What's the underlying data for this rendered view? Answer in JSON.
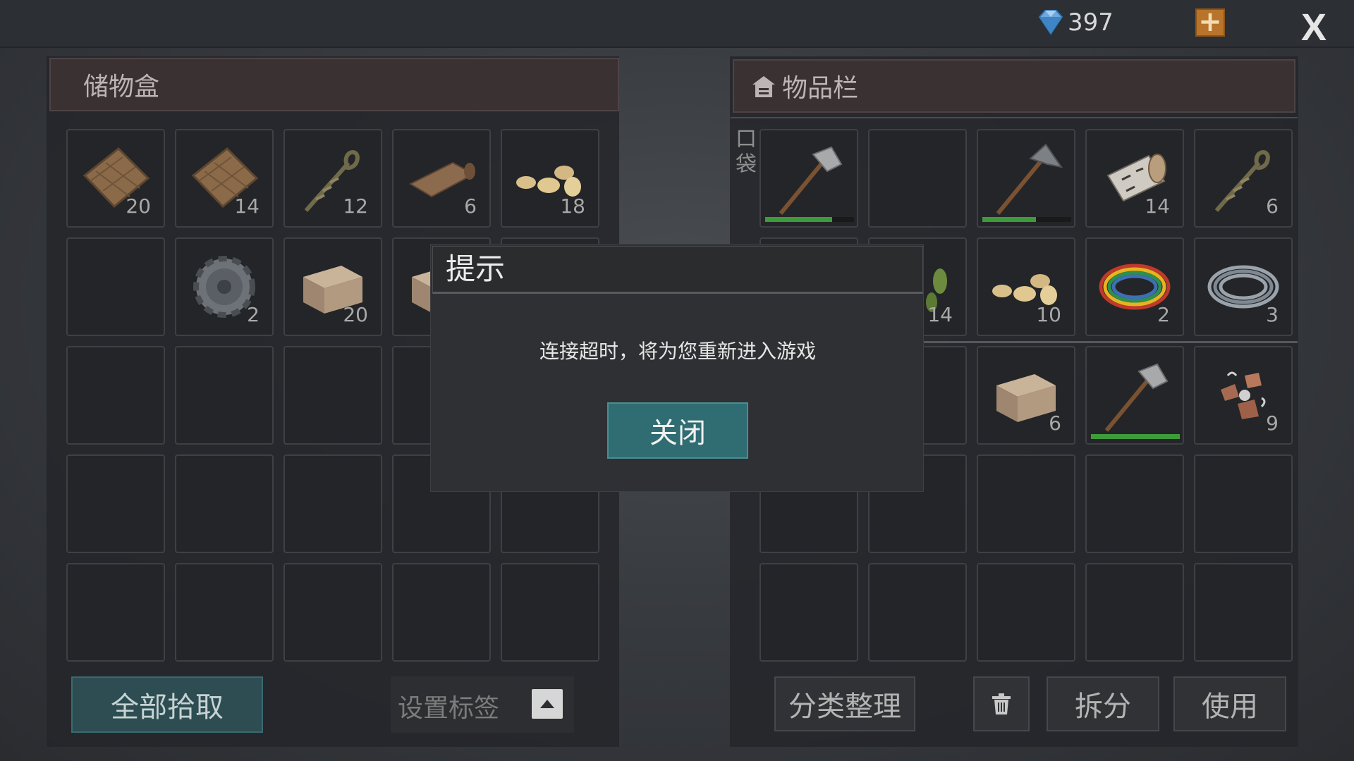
{
  "top": {
    "gem_icon": "diamond-icon",
    "gem_count": "397",
    "add_label": "+",
    "close_label": "X"
  },
  "storage": {
    "title": "储物盒",
    "slots": [
      {
        "item": "burlap-cloth",
        "count": "20"
      },
      {
        "item": "burlap-cloth",
        "count": "14"
      },
      {
        "item": "rope",
        "count": "12"
      },
      {
        "item": "leather-roll",
        "count": "6"
      },
      {
        "item": "seeds",
        "count": "18"
      },
      {
        "item": "",
        "count": ""
      },
      {
        "item": "gear",
        "count": "2"
      },
      {
        "item": "stone-block",
        "count": "20"
      },
      {
        "item": "stone-block",
        "count": ""
      },
      {
        "item": "",
        "count": ""
      }
    ],
    "pick_all_label": "全部拾取",
    "tag_label": "设置标签"
  },
  "inventory": {
    "title": "物品栏",
    "pocket_label": "口袋",
    "slots": [
      {
        "item": "stone-axe",
        "count": "",
        "durability": 0.75
      },
      {
        "item": "",
        "count": ""
      },
      {
        "item": "stone-pickaxe",
        "count": "",
        "durability": 0.6
      },
      {
        "item": "birch-log",
        "count": "14"
      },
      {
        "item": "rope",
        "count": "6"
      },
      {
        "item": "",
        "count": ""
      },
      {
        "item": "leaves",
        "count": "14"
      },
      {
        "item": "seeds",
        "count": "10"
      },
      {
        "item": "wire-coil",
        "count": "2"
      },
      {
        "item": "steel-wire",
        "count": "3"
      },
      {
        "item": "",
        "count": ""
      },
      {
        "item": "",
        "count": ""
      },
      {
        "item": "stone-block",
        "count": "6"
      },
      {
        "item": "stone-axe",
        "count": "",
        "durability": 1.0
      },
      {
        "item": "scrap",
        "count": "9"
      }
    ],
    "sort_label": "分类整理",
    "trash_icon": "trash-icon",
    "split_label": "拆分",
    "use_label": "使用"
  },
  "dialog": {
    "title": "提示",
    "message": "连接超时，将为您重新进入游戏",
    "close_label": "关闭"
  },
  "colors": {
    "accent_teal": "#2f6d72",
    "durability_green": "#3e9b3a",
    "plus_orange": "#b8742a"
  }
}
